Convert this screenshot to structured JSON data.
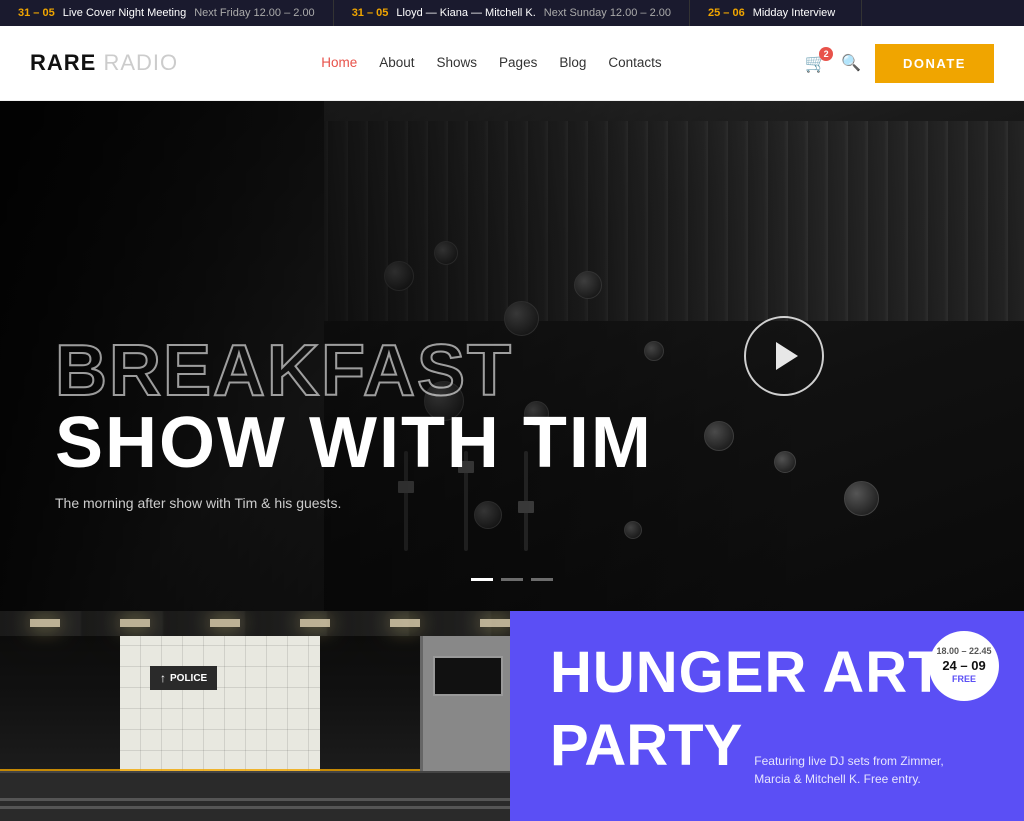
{
  "ticker": {
    "items": [
      {
        "date": "31 – 05",
        "title": "Live Cover Night Meeting",
        "time": "Next Friday 12.00 – 2.00"
      },
      {
        "date": "31 – 05",
        "title": "Lloyd — Kiana — Mitchell K.",
        "time": "Next Sunday 12.00 – 2.00"
      },
      {
        "date": "25 – 06",
        "title": "Midday Interview",
        "time": ""
      }
    ]
  },
  "header": {
    "logo_bold": "RARE",
    "logo_light": "RADIO",
    "nav": [
      {
        "label": "Home",
        "active": true
      },
      {
        "label": "About",
        "active": false
      },
      {
        "label": "Shows",
        "active": false
      },
      {
        "label": "Pages",
        "active": false
      },
      {
        "label": "Blog",
        "active": false
      },
      {
        "label": "Contacts",
        "active": false
      }
    ],
    "cart_count": "2",
    "donate_label": "DONATE"
  },
  "hero": {
    "title_outline": "BREAKFAST",
    "title_solid": "SHOW WITH TIM",
    "subtitle": "The morning after show with Tim & his guests.",
    "dots": [
      "active",
      "inactive",
      "inactive"
    ]
  },
  "bottom": {
    "subway_sign": "POLICE",
    "event": {
      "badge_time": "18.00 – 22.45",
      "badge_date": "24 – 09",
      "badge_free": "FREE",
      "name_line1": "HUNGER ART",
      "name_line2": "PARTY",
      "description": "Featuring live DJ sets from Zimmer, Marcia & Mitchell K. Free entry."
    }
  }
}
